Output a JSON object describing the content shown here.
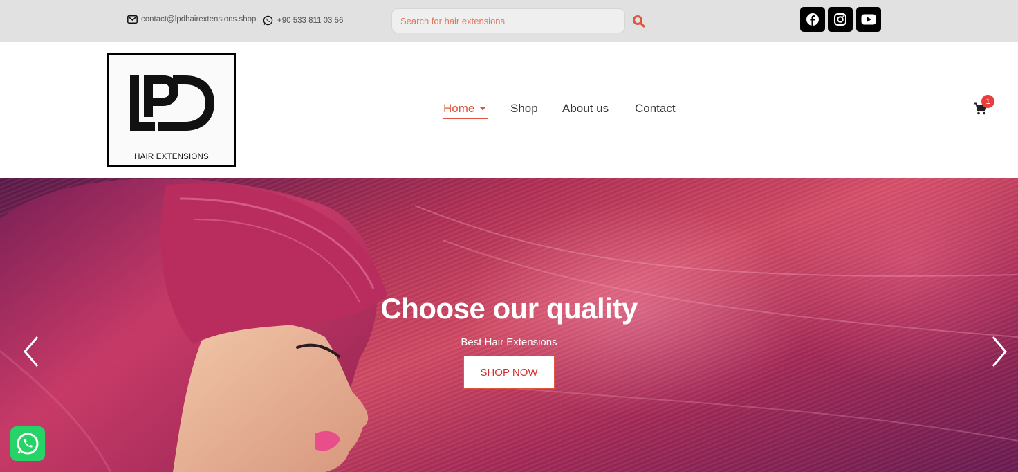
{
  "topbar": {
    "email": "contact@lpdhairextensions.shop",
    "phone": "+90 533 811 03 56",
    "search_placeholder": "Search for hair extensions",
    "social": [
      {
        "icon": "facebook-icon"
      },
      {
        "icon": "instagram-icon"
      },
      {
        "icon": "youtube-icon"
      }
    ]
  },
  "header": {
    "logo_letters": "LPD",
    "logo_subtitle": "HAIR EXTENSIONS",
    "nav": {
      "home": "Home",
      "shop": "Shop",
      "about": "About us",
      "contact": "Contact"
    },
    "cart_count": "1"
  },
  "hero": {
    "title": "Choose our quality",
    "subtitle": "Best Hair Extensions",
    "button": "SHOP NOW"
  },
  "colors": {
    "accent": "#e0553f",
    "topbar_bg": "#e1e1e1",
    "badge": "#e83e3e",
    "whatsapp": "#25d366"
  }
}
